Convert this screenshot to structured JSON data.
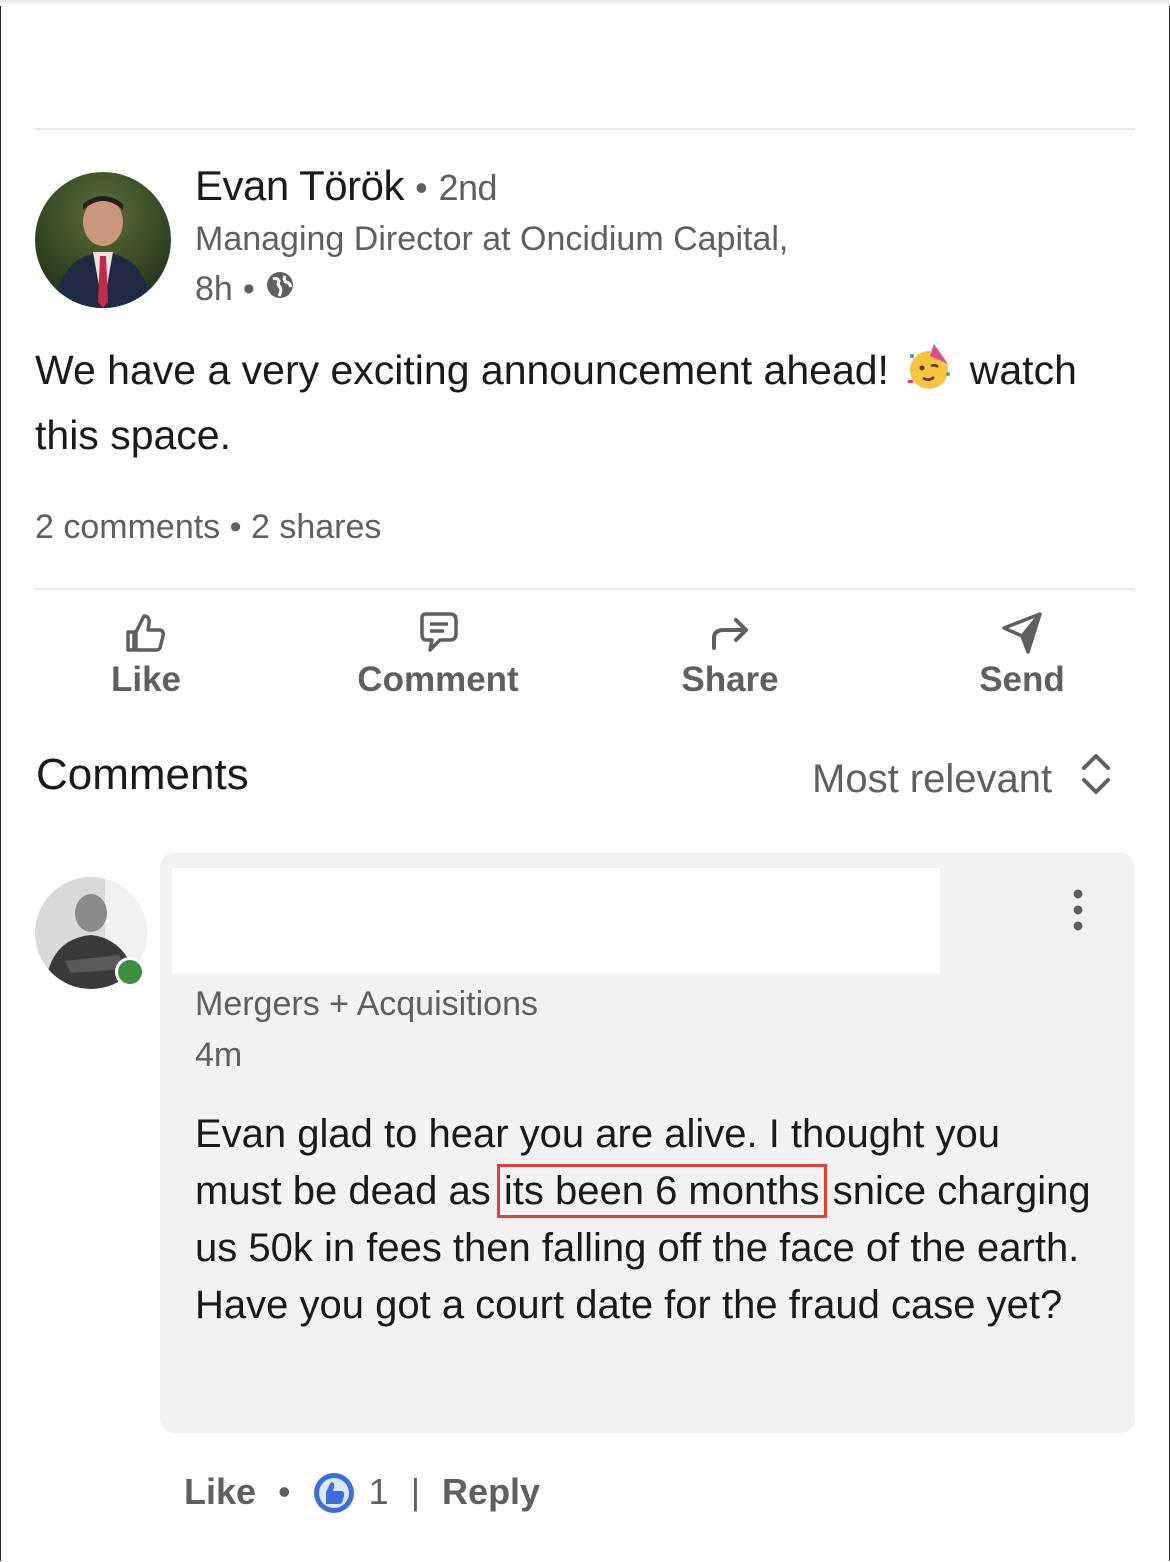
{
  "post": {
    "author_name": "Evan Török",
    "degree": "2nd",
    "separator": "•",
    "headline": "Managing Director at Oncidium Capital,",
    "time": "8h",
    "visibility_icon": "globe-icon",
    "text_before_emoji": "We have a very exciting announcement ahead!",
    "emoji": "partying-face-emoji",
    "text_after_emoji": "watch this space.",
    "stats": "2 comments • 2 shares"
  },
  "actions": {
    "like": "Like",
    "comment": "Comment",
    "share": "Share",
    "send": "Send"
  },
  "comments_section": {
    "title": "Comments",
    "sort_label": "Most relevant"
  },
  "comment": {
    "author_name_redacted": true,
    "headline": "Mergers + Acquisitions",
    "time": "4m",
    "text_before_highlight": "Evan glad to hear you are alive. I thought you must be dead as ",
    "text_highlight": "its been 6 months",
    "text_after_highlight": " snice charging us 50k in fees then falling off the face of the earth. Have you got a court date for the fraud case yet?",
    "like_label": "Like",
    "dot": "•",
    "reaction_count": "1",
    "pipe": "|",
    "reply_label": "Reply",
    "online_status_color": "#3c8f3c"
  },
  "colors": {
    "highlight_box": "#e0432f",
    "reaction_blue": "#3b6fd8",
    "bubble": "#f2f2f2"
  }
}
